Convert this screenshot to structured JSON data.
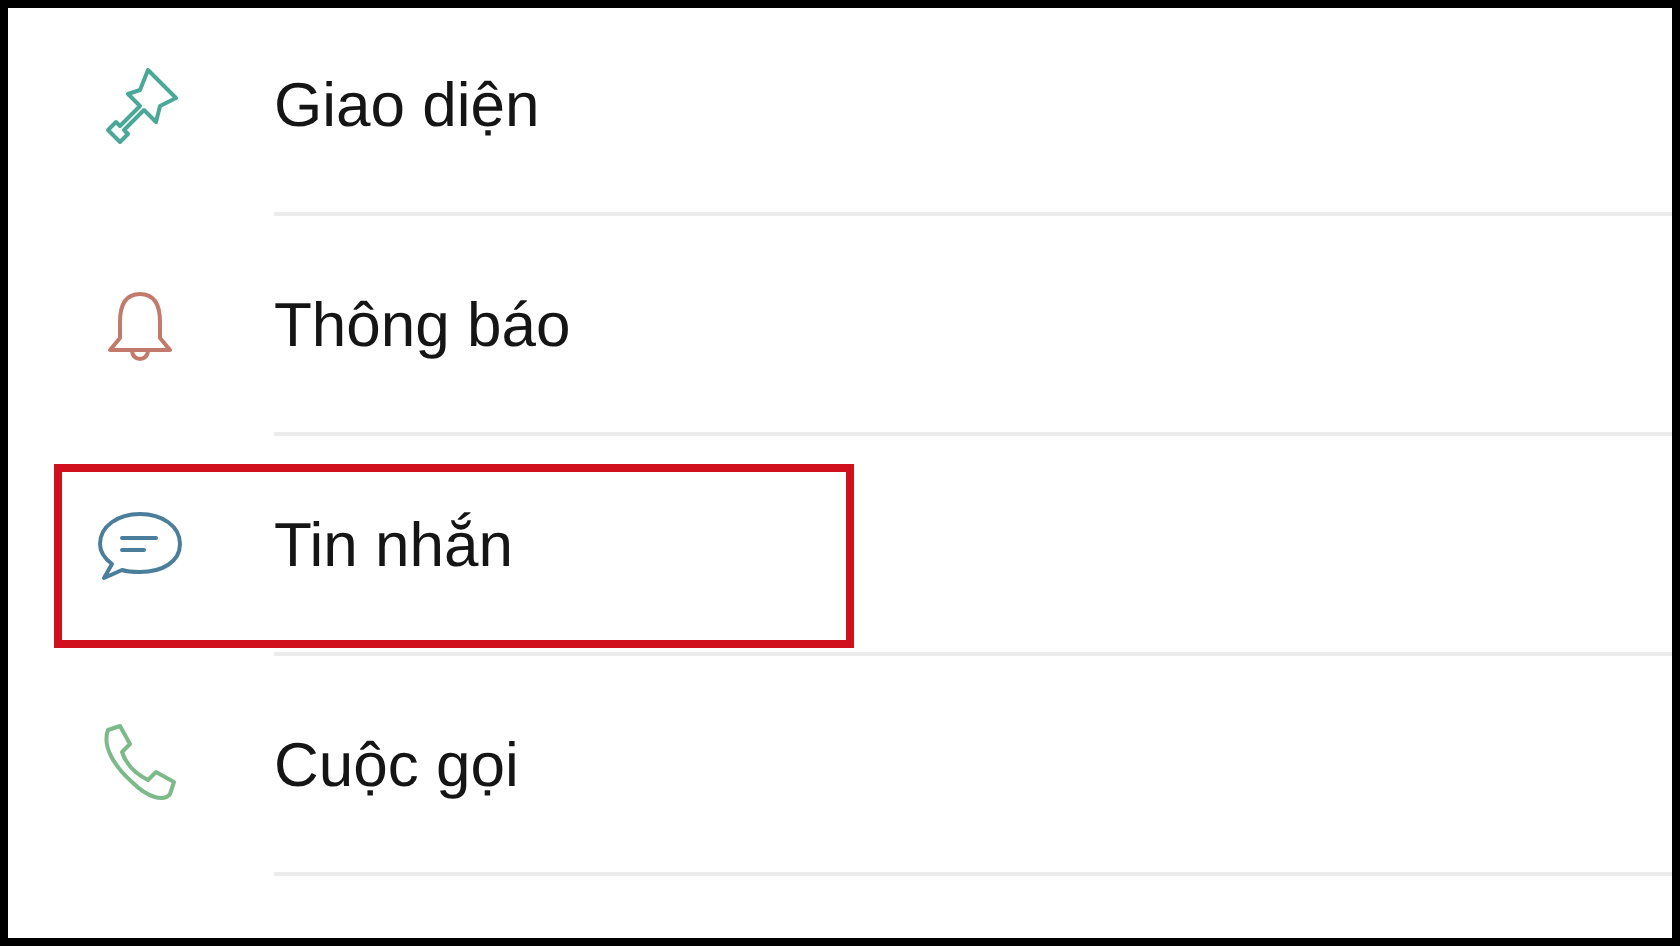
{
  "settings": {
    "items": [
      {
        "kind": "brush",
        "color": "#4aa898",
        "label": "Giao diện",
        "highlighted": false
      },
      {
        "kind": "bell",
        "color": "#c27a6c",
        "label": "Thông báo",
        "highlighted": false
      },
      {
        "kind": "chat",
        "color": "#4a7e9a",
        "label": "Tin nhắn",
        "highlighted": true
      },
      {
        "kind": "phone",
        "color": "#7cba8a",
        "label": "Cuộc gọi",
        "highlighted": false
      }
    ]
  }
}
